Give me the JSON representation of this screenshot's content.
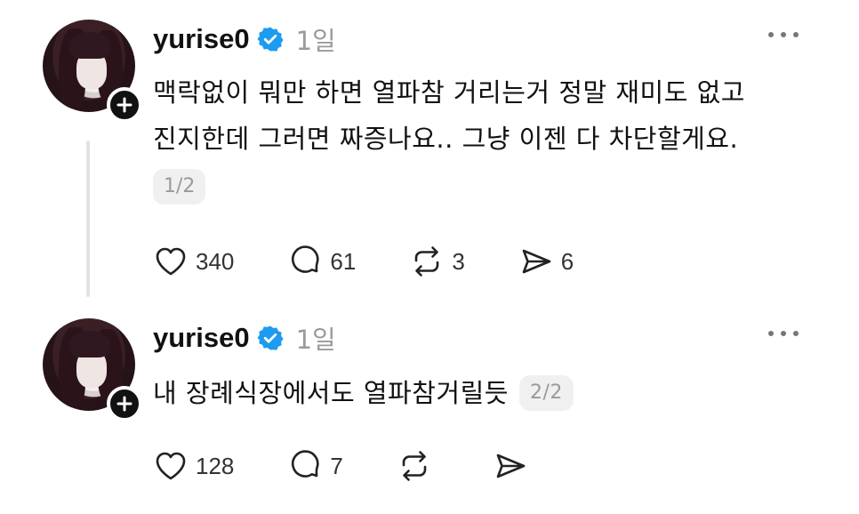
{
  "posts": [
    {
      "username": "yurise0",
      "time": "1일",
      "lines": [
        "맥락없이 뭐만 하면 열파참 거리는거 정말 재미도 없고",
        "진지한데 그러면 짜증나요.. 그냥 이젠 다 차단할게요."
      ],
      "page_indicator": "1/2",
      "likes": "340",
      "comments": "61",
      "reposts": "3",
      "shares": "6"
    },
    {
      "username": "yurise0",
      "time": "1일",
      "text": "내 장례식장에서도 열파참거릴듯",
      "page_indicator": "2/2",
      "likes": "128",
      "comments": "7",
      "reposts": "",
      "shares": ""
    }
  ],
  "icons": {
    "verified": "verified-badge-icon",
    "more": "more-options-icon",
    "follow": "plus-icon",
    "like": "heart-icon",
    "comment": "comment-icon",
    "repost": "repost-icon",
    "share": "share-icon"
  },
  "colors": {
    "verified_blue": "#1d9bf0",
    "muted_gray": "#9a9a9a",
    "text": "#111111"
  }
}
